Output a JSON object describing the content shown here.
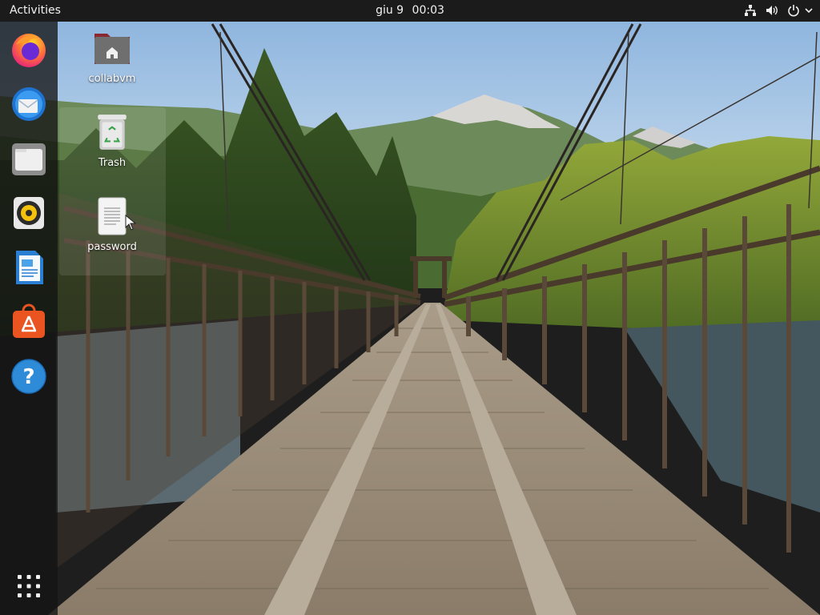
{
  "topbar": {
    "activities_label": "Activities",
    "date": "giu 9",
    "time": "00:03",
    "tray_icons": [
      "network-wired-icon",
      "volume-icon",
      "power-icon",
      "chevron-down-icon"
    ]
  },
  "dock": {
    "items": [
      {
        "name": "firefox",
        "icon": "firefox-icon",
        "running": false
      },
      {
        "name": "thunderbird",
        "icon": "thunderbird-icon",
        "running": false
      },
      {
        "name": "files",
        "icon": "folder-icon",
        "running": false
      },
      {
        "name": "rhythmbox",
        "icon": "speaker-icon",
        "running": false
      },
      {
        "name": "libreoffice-writer",
        "icon": "document-icon",
        "running": false
      },
      {
        "name": "ubuntu-software",
        "icon": "software-bag-icon",
        "running": false
      },
      {
        "name": "help",
        "icon": "help-icon",
        "running": false
      },
      {
        "name": "show-applications",
        "icon": "app-grid-icon",
        "running": false
      }
    ]
  },
  "desktop": {
    "icons": [
      {
        "label": "collabvm",
        "icon": "home-folder-icon"
      },
      {
        "label": "Trash",
        "icon": "trash-icon"
      },
      {
        "label": "password",
        "icon": "text-file-icon"
      }
    ]
  },
  "colors": {
    "topbar_bg": "#1b1b1b",
    "accent": "#e95420",
    "sky": "#a9c7e6"
  }
}
